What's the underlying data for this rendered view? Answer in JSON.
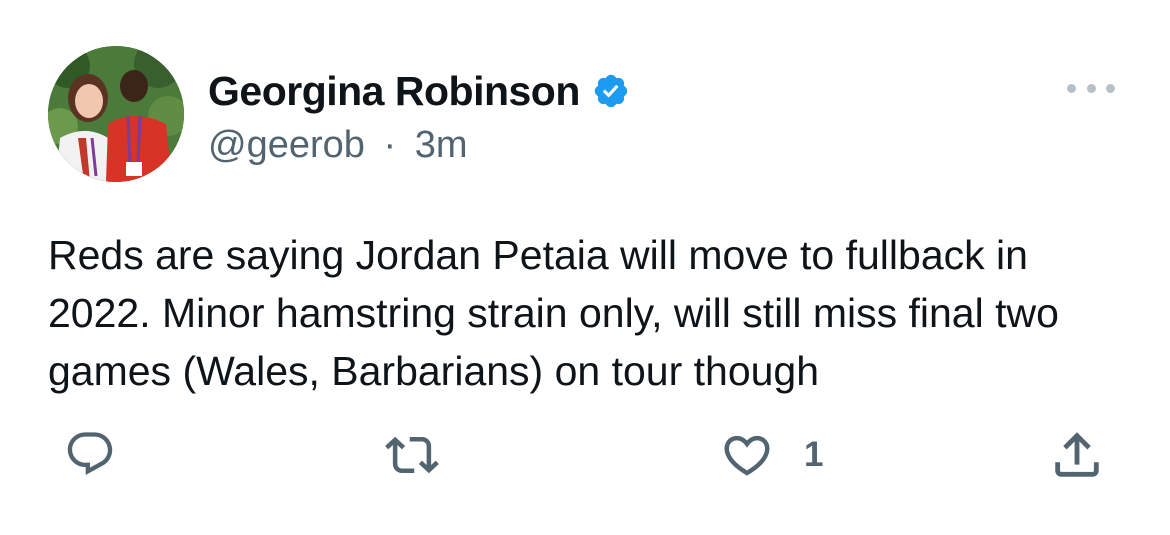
{
  "author": {
    "display_name": "Georgina Robinson",
    "handle": "@geerob",
    "separator": "·",
    "time": "3m",
    "verified": true,
    "avatar_icon": "avatar-photo-icon",
    "verified_icon": "verified-badge-icon"
  },
  "tweet": {
    "text": "Reds are saying Jordan Petaia will move to fullback in 2022. Minor hamstring strain only, will still miss final two games (Wales, Barbarians) on tour though"
  },
  "actions": {
    "reply_icon": "reply-icon",
    "retweet_icon": "retweet-icon",
    "like_icon": "like-heart-icon",
    "like_count": "1",
    "share_icon": "share-icon",
    "more_icon": "more-options-icon"
  },
  "colors": {
    "text_primary": "#0f1419",
    "text_secondary": "#536471",
    "verified_blue": "#1d9bf0",
    "icon_gray": "#536471"
  }
}
